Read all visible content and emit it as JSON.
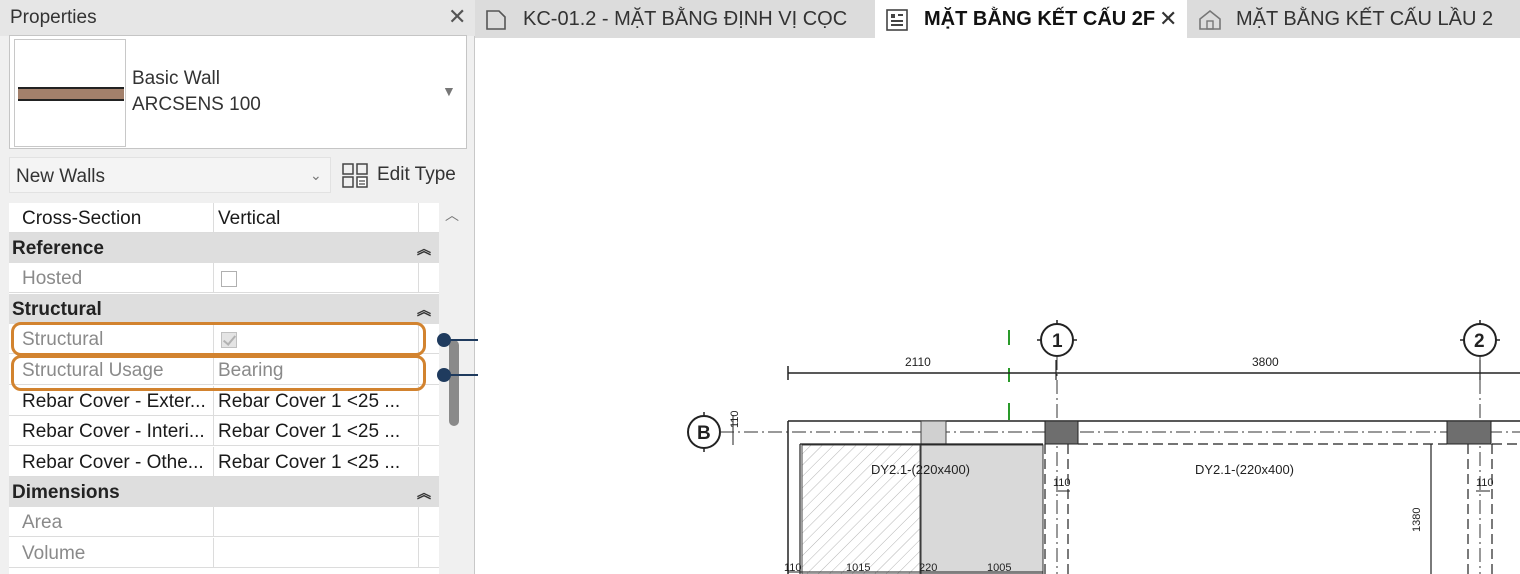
{
  "properties": {
    "title": "Properties",
    "type_family": "Basic Wall",
    "type_name": "ARCSENS 100",
    "instance_filter": "New Walls",
    "edit_type_label": "Edit Type",
    "rows": {
      "cross_section": {
        "label": "Cross-Section",
        "value": "Vertical"
      },
      "reference_header": "Reference",
      "hosted": {
        "label": "Hosted"
      },
      "structural_header": "Structural",
      "structural": {
        "label": "Structural"
      },
      "structural_usage": {
        "label": "Structural Usage",
        "value": "Bearing"
      },
      "rebar_exterior": {
        "label": "Rebar Cover - Exter...",
        "value": "Rebar Cover 1 <25 ..."
      },
      "rebar_interior": {
        "label": "Rebar Cover - Interi...",
        "value": "Rebar Cover 1 <25 ..."
      },
      "rebar_other": {
        "label": "Rebar Cover - Othe...",
        "value": "Rebar Cover 1 <25 ..."
      },
      "dimensions_header": "Dimensions",
      "area": {
        "label": "Area"
      },
      "volume": {
        "label": "Volume"
      }
    },
    "hosted_checked": false,
    "structural_checked": true
  },
  "callouts": [
    "1",
    "2"
  ],
  "tabs": [
    {
      "label": "KC-01.2 - MẶT BẰNG ĐỊNH VỊ CỌC",
      "active": false
    },
    {
      "label": "MẶT BẰNG KẾT CẤU 2F",
      "active": true
    },
    {
      "label": "MẶT BẰNG KẾT CẤU LẦU 2",
      "active": false
    }
  ],
  "drawing": {
    "grid_labels": {
      "g1": "1",
      "g2": "2",
      "gB": "B"
    },
    "dims": {
      "d1": "2110",
      "d2": "3800",
      "d3": "110",
      "d4": "110",
      "d5": "110",
      "d6": "1380",
      "d7": "110",
      "d8": "1015",
      "d9": "220",
      "d10": "1005"
    },
    "beams": {
      "b1": "DY2.1-(220x400)",
      "b2": "DY2.1-(220x400)"
    }
  },
  "colors": {
    "callout": "#1f3b5e",
    "highlight": "#d2832f",
    "wall_swatch": "#a3806b"
  }
}
